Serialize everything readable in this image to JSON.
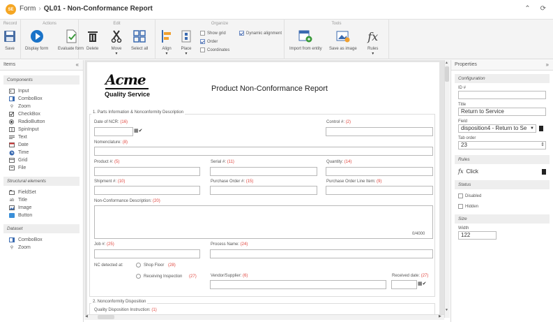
{
  "header": {
    "logo": "SE",
    "crumb_root": "Form",
    "crumb_sep": "›",
    "title": "QL01 - Non-Conformance Report",
    "icon_collapse": "chevrons-up-icon",
    "icon_refresh": "refresh-icon"
  },
  "ribbon": {
    "groups": {
      "record": "Record",
      "actions": "Actions",
      "edit": "Edit",
      "organize": "Organize",
      "tools": "Tools"
    },
    "save": "Save",
    "display_form": "Display form",
    "evaluate_form": "Evaluate form",
    "delete": "Delete",
    "move": "Move",
    "select_all": "Select all",
    "align": "Align",
    "place": "Place",
    "show_grid": "Show grid",
    "order": "Order",
    "coordinates": "Coordinates",
    "dynamic_alignment": "Dynamic alignment",
    "import_entity": "Import from entity",
    "save_image": "Save as image",
    "rules": "Rules"
  },
  "left": {
    "title": "Items",
    "collapse": "«",
    "components_title": "Components",
    "components": [
      "Input",
      "ComboBox",
      "Zoom",
      "CheckBox",
      "RadioButton",
      "SpinInput",
      "Text",
      "Date",
      "Time",
      "Grid",
      "File"
    ],
    "structural_title": "Structural elements",
    "structural": [
      "FieldSet",
      "Title",
      "Image",
      "Button"
    ],
    "dataset_title": "Dataset",
    "dataset": [
      "ComboBox",
      "Zoom"
    ]
  },
  "form": {
    "brand": "Acme",
    "brand_tag": "Quality Service",
    "title": "Product Non-Conformance Report",
    "section1": "1. Parts Information & Nonconformity Description",
    "section2": "2. Nonconformity Disposition",
    "fields": {
      "date_ncr": "Date of NCR:",
      "date_ncr_n": "(16)",
      "control": "Control #:",
      "control_n": "(2)",
      "nomenclature": "Nomenclature:",
      "nomenclature_n": "(8)",
      "product": "Product #:",
      "product_n": "(5)",
      "serial": "Serial #:",
      "serial_n": "(11)",
      "quantity": "Quantity:",
      "quantity_n": "(14)",
      "shipment": "Shipment #:",
      "shipment_n": "(10)",
      "po": "Purchase Order #:",
      "po_n": "(15)",
      "poline": "Purchase Order Line Item:",
      "poline_n": "(9)",
      "ncdesc": "Non-Conformance Description:",
      "ncdesc_n": "(20)",
      "counter": "0/4000",
      "job": "Job #:",
      "job_n": "(25)",
      "process": "Process Name:",
      "process_n": "(24)",
      "ncat": "NC detected at:",
      "shop": "Shop Floor",
      "shop_n": "(28)",
      "receiving": "Receiving Inspection",
      "receiving_n": "(27)",
      "vendor": "Vendor/Supplier:",
      "vendor_n": "(6)",
      "received": "Received date:",
      "received_n": "(27)",
      "qdi": "Quality Disposition Instruction:",
      "qdi_n": "(1)"
    }
  },
  "right": {
    "title": "Properties",
    "expand": "»",
    "configuration": "Configuration",
    "id_label": "ID #",
    "id_value": "",
    "title_label": "Title",
    "title_value": "Return to Service",
    "field_label": "Field",
    "field_value": "disposition4 - Return to Se",
    "taborder_label": "Tab order",
    "taborder_value": "23",
    "rules": "Rules",
    "click": "Click",
    "status": "Status",
    "disabled": "Disabled",
    "hidden": "Hidden",
    "size": "Size",
    "width_label": "Width",
    "width_value": "122"
  }
}
